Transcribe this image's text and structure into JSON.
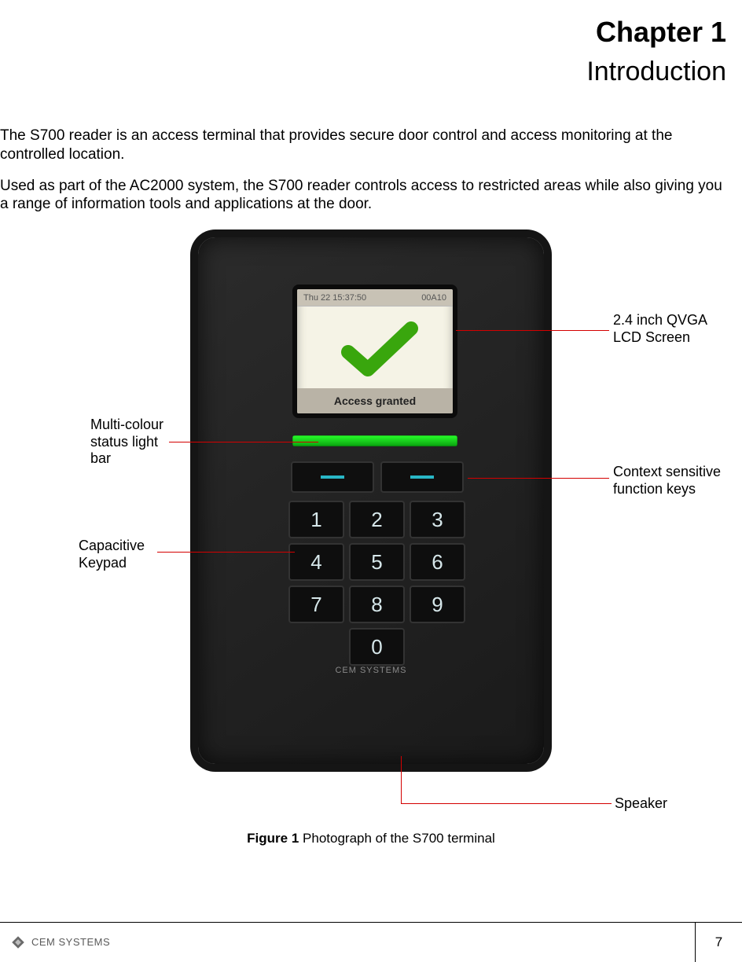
{
  "title": {
    "chapter": "Chapter 1",
    "subtitle": "Introduction"
  },
  "paragraphs": {
    "p1": "The S700 reader is an access terminal that provides secure door control and access monitoring at the controlled location.",
    "p2": "Used as part of the AC2000 system, the S700 reader controls access to restricted areas while also giving you a range of information tools and applications at the door."
  },
  "device": {
    "screen_top_left": "Thu 22 15:37:50",
    "screen_top_right": "00A10",
    "screen_message": "Access granted",
    "keys": [
      "1",
      "2",
      "3",
      "4",
      "5",
      "6",
      "7",
      "8",
      "9",
      "0"
    ],
    "brand": "CEM SYSTEMS"
  },
  "callouts": {
    "lcd": "2.4 inch QVGA LCD Screen",
    "status_bar": "Multi-colour status light bar",
    "function_keys": "Context sensitive function keys",
    "keypad": "Capacitive Keypad",
    "speaker": "Speaker"
  },
  "figure": {
    "label": "Figure 1",
    "caption": "Photograph of the S700 terminal"
  },
  "footer": {
    "brand": "CEM SYSTEMS",
    "page_number": "7"
  }
}
